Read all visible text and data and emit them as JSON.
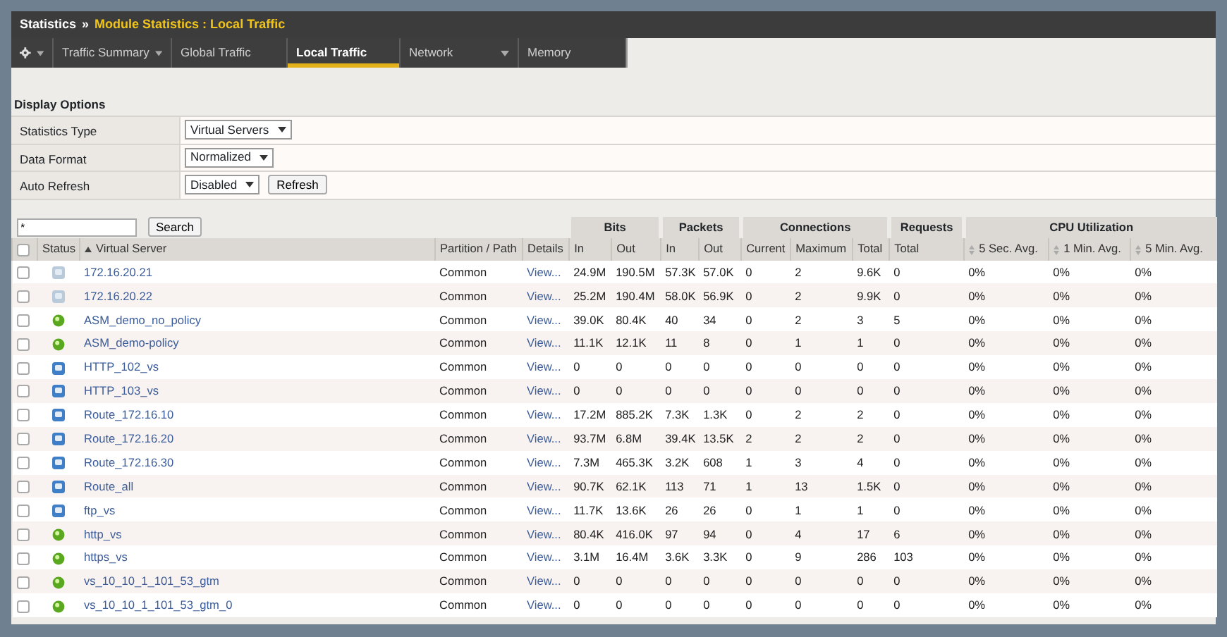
{
  "breadcrumb": {
    "section": "Statistics",
    "separator": "»",
    "page": "Module Statistics : Local Traffic"
  },
  "tabs": [
    {
      "kind": "gear",
      "has_menu": true,
      "selected": false
    },
    {
      "label": "Traffic Summary",
      "kind": "text",
      "has_menu": true,
      "selected": false
    },
    {
      "label": "Global Traffic",
      "kind": "text",
      "has_menu": false,
      "selected": false
    },
    {
      "label": "Local Traffic",
      "kind": "text",
      "has_menu": false,
      "selected": true
    },
    {
      "label": "Network",
      "kind": "text",
      "has_menu": true,
      "selected": false
    },
    {
      "label": "Memory",
      "kind": "text",
      "has_menu": false,
      "selected": false
    }
  ],
  "display_options": {
    "title": "Display Options",
    "rows": [
      {
        "label": "Statistics Type",
        "select": "Virtual Servers"
      },
      {
        "label": "Data Format",
        "select": "Normalized"
      },
      {
        "label": "Auto Refresh",
        "select": "Disabled",
        "button": "Refresh"
      }
    ]
  },
  "filter": {
    "value": "*",
    "button": "Search"
  },
  "table": {
    "select_all": {
      "checked": false
    },
    "columns": [
      {
        "label": "Status"
      },
      {
        "label": "Virtual Server",
        "sorted": true
      },
      {
        "label": "Partition / Path"
      },
      {
        "label": "Details"
      },
      {
        "label": "Bits",
        "children": [
          {
            "label": "In"
          },
          {
            "label": "Out"
          }
        ]
      },
      {
        "label": "Packets",
        "children": [
          {
            "label": "In"
          },
          {
            "label": "Out"
          }
        ]
      },
      {
        "label": "Connections",
        "children": [
          {
            "label": "Current"
          },
          {
            "label": "Maximum"
          },
          {
            "label": "Total"
          }
        ]
      },
      {
        "label": "Requests",
        "children": [
          {
            "label": "Total"
          }
        ]
      },
      {
        "label": "CPU Utilization",
        "children": [
          {
            "label": "5 Sec. Avg.",
            "sortable": true
          },
          {
            "label": "1 Min. Avg.",
            "sortable": true
          },
          {
            "label": "5 Min. Avg.",
            "sortable": true
          }
        ]
      }
    ],
    "rows": [
      {
        "selected": false,
        "status": {
          "kind": "square",
          "color": "#b9cadb"
        },
        "name": "172.16.20.21",
        "partition": "Common",
        "details": "View...",
        "values": [
          "24.9M",
          "190.5M",
          "57.3K",
          "57.0K",
          "0",
          "2",
          "9.6K",
          "0",
          "0%",
          "0%",
          "0%"
        ]
      },
      {
        "selected": false,
        "status": {
          "kind": "square",
          "color": "#b9cadb"
        },
        "name": "172.16.20.22",
        "partition": "Common",
        "details": "View...",
        "values": [
          "25.2M",
          "190.4M",
          "58.0K",
          "56.9K",
          "0",
          "2",
          "9.9K",
          "0",
          "0%",
          "0%",
          "0%"
        ]
      },
      {
        "selected": false,
        "status": {
          "kind": "circle",
          "color": "#5aa820"
        },
        "name": "ASM_demo_no_policy",
        "partition": "Common",
        "details": "View...",
        "values": [
          "39.0K",
          "80.4K",
          "40",
          "34",
          "0",
          "2",
          "3",
          "5",
          "0%",
          "0%",
          "0%"
        ]
      },
      {
        "selected": false,
        "status": {
          "kind": "circle",
          "color": "#5aa820"
        },
        "name": "ASM_demo-policy",
        "partition": "Common",
        "details": "View...",
        "values": [
          "11.1K",
          "12.1K",
          "11",
          "8",
          "0",
          "1",
          "1",
          "0",
          "0%",
          "0%",
          "0%"
        ]
      },
      {
        "selected": false,
        "status": {
          "kind": "square",
          "color": "#3f7fc7"
        },
        "name": "HTTP_102_vs",
        "partition": "Common",
        "details": "View...",
        "values": [
          "0",
          "0",
          "0",
          "0",
          "0",
          "0",
          "0",
          "0",
          "0%",
          "0%",
          "0%"
        ]
      },
      {
        "selected": false,
        "status": {
          "kind": "square",
          "color": "#3f7fc7"
        },
        "name": "HTTP_103_vs",
        "partition": "Common",
        "details": "View...",
        "values": [
          "0",
          "0",
          "0",
          "0",
          "0",
          "0",
          "0",
          "0",
          "0%",
          "0%",
          "0%"
        ]
      },
      {
        "selected": false,
        "status": {
          "kind": "square",
          "color": "#3f7fc7"
        },
        "name": "Route_172.16.10",
        "partition": "Common",
        "details": "View...",
        "values": [
          "17.2M",
          "885.2K",
          "7.3K",
          "1.3K",
          "0",
          "2",
          "2",
          "0",
          "0%",
          "0%",
          "0%"
        ]
      },
      {
        "selected": false,
        "status": {
          "kind": "square",
          "color": "#3f7fc7"
        },
        "name": "Route_172.16.20",
        "partition": "Common",
        "details": "View...",
        "values": [
          "93.7M",
          "6.8M",
          "39.4K",
          "13.5K",
          "2",
          "2",
          "2",
          "0",
          "0%",
          "0%",
          "0%"
        ]
      },
      {
        "selected": false,
        "status": {
          "kind": "square",
          "color": "#3f7fc7"
        },
        "name": "Route_172.16.30",
        "partition": "Common",
        "details": "View...",
        "values": [
          "7.3M",
          "465.3K",
          "3.2K",
          "608",
          "1",
          "3",
          "4",
          "0",
          "0%",
          "0%",
          "0%"
        ]
      },
      {
        "selected": false,
        "status": {
          "kind": "square",
          "color": "#3f7fc7"
        },
        "name": "Route_all",
        "partition": "Common",
        "details": "View...",
        "values": [
          "90.7K",
          "62.1K",
          "113",
          "71",
          "1",
          "13",
          "1.5K",
          "0",
          "0%",
          "0%",
          "0%"
        ]
      },
      {
        "selected": false,
        "status": {
          "kind": "square",
          "color": "#3f7fc7"
        },
        "name": "ftp_vs",
        "partition": "Common",
        "details": "View...",
        "values": [
          "11.7K",
          "13.6K",
          "26",
          "26",
          "0",
          "1",
          "1",
          "0",
          "0%",
          "0%",
          "0%"
        ]
      },
      {
        "selected": false,
        "status": {
          "kind": "circle",
          "color": "#5aa820"
        },
        "name": "http_vs",
        "partition": "Common",
        "details": "View...",
        "values": [
          "80.4K",
          "416.0K",
          "97",
          "94",
          "0",
          "4",
          "17",
          "6",
          "0%",
          "0%",
          "0%"
        ]
      },
      {
        "selected": false,
        "status": {
          "kind": "circle",
          "color": "#5aa820"
        },
        "name": "https_vs",
        "partition": "Common",
        "details": "View...",
        "values": [
          "3.1M",
          "16.4M",
          "3.6K",
          "3.3K",
          "0",
          "9",
          "286",
          "103",
          "0%",
          "0%",
          "0%"
        ]
      },
      {
        "selected": false,
        "status": {
          "kind": "circle",
          "color": "#5aa820"
        },
        "name": "vs_10_10_1_101_53_gtm",
        "partition": "Common",
        "details": "View...",
        "values": [
          "0",
          "0",
          "0",
          "0",
          "0",
          "0",
          "0",
          "0",
          "0%",
          "0%",
          "0%"
        ]
      },
      {
        "selected": false,
        "status": {
          "kind": "circle",
          "color": "#5aa820"
        },
        "name": "vs_10_10_1_101_53_gtm_0",
        "partition": "Common",
        "details": "View...",
        "values": [
          "0",
          "0",
          "0",
          "0",
          "0",
          "0",
          "0",
          "0",
          "0%",
          "0%",
          "0%"
        ]
      }
    ]
  }
}
